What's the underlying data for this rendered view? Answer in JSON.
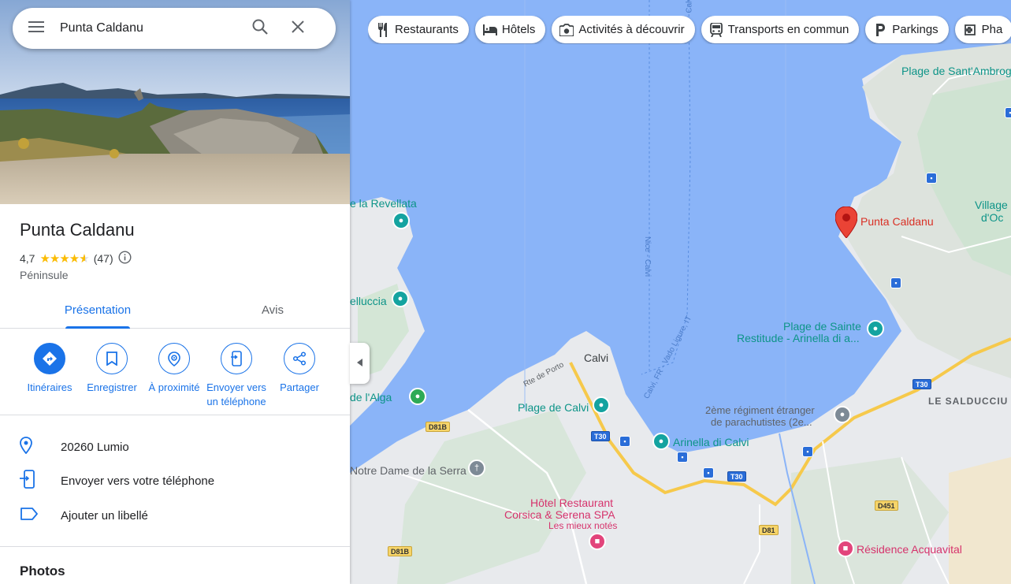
{
  "search": {
    "value": "Punta Caldanu"
  },
  "place": {
    "title": "Punta Caldanu",
    "rating": "4,7",
    "stars": 4.7,
    "review_count": "(47)",
    "category": "Péninsule"
  },
  "tabs": [
    {
      "label": "Présentation",
      "active": true
    },
    {
      "label": "Avis",
      "active": false
    }
  ],
  "actions": [
    {
      "label": "Itinéraires",
      "icon": "directions-icon"
    },
    {
      "label": "Enregistrer",
      "icon": "bookmark-icon"
    },
    {
      "label": "À proximité",
      "icon": "nearby-icon"
    },
    {
      "label": "Envoyer vers un téléphone",
      "icon": "send-to-phone-icon"
    },
    {
      "label": "Partager",
      "icon": "share-icon"
    }
  ],
  "info": [
    {
      "text": "20260 Lumio",
      "icon": "location-pin-icon"
    },
    {
      "text": "Envoyer vers votre téléphone",
      "icon": "phone-icon"
    },
    {
      "text": "Ajouter un libellé",
      "icon": "label-icon"
    }
  ],
  "photos_heading": "Photos",
  "chips": [
    {
      "label": "Restaurants",
      "icon": "restaurant-icon"
    },
    {
      "label": "Hôtels",
      "icon": "hotel-icon"
    },
    {
      "label": "Activités à découvrir",
      "icon": "camera-icon"
    },
    {
      "label": "Transports en commun",
      "icon": "transit-icon"
    },
    {
      "label": "Parkings",
      "icon": "parking-icon"
    },
    {
      "label": "Pha",
      "icon": "pharmacy-icon"
    }
  ],
  "map": {
    "labels": {
      "plage_sant_ambroggio": "Plage de Sant'Ambroggio",
      "la_revellata": "e la Revellata",
      "punta_caldanu": "Punta Caldanu",
      "village_1": "Village",
      "village_2": "d'Oc",
      "elluccia": "elluccia",
      "plage_sainte_1": "Plage de Sainte",
      "plage_sainte_2": "Restitude - Arinella di a...",
      "calvi": "Calvi",
      "rte_de_porto": "Rte de Porto",
      "ferry_nice_calvi": "Nice - Calvi",
      "ferry_vado": "Calvi, FR - Vado Ligure, IT",
      "ferry_top": "Calvi",
      "de_lalga": "de l'Alga",
      "plage_de_calvi": "Plage de Calvi",
      "regiment_1": "2ème régiment étranger",
      "regiment_2": "de parachutistes (2e...",
      "le_salducciu": "LE SALDUCCIU",
      "arinella": "Arinella di Calvi",
      "notre_dame": "Notre Dame de la Serra",
      "hotel_1": "Hôtel Restaurant",
      "hotel_2": "Corsica & Serena SPA",
      "hotel_3": "Les mieux notés",
      "residence": "Résidence Acquavital"
    },
    "roads": {
      "d81b_1": "D81B",
      "d81b_2": "D81B",
      "t30_1": "T30",
      "t30_2": "T30",
      "t30_3": "T30",
      "d451": "D451",
      "d81": "D81"
    }
  },
  "colors": {
    "accent": "#1a73e8",
    "water": "#8ab4f8",
    "land": "#e8eaed",
    "park": "#cde8d0",
    "marker": "#ea4335",
    "road_major": "#f6c94b"
  }
}
